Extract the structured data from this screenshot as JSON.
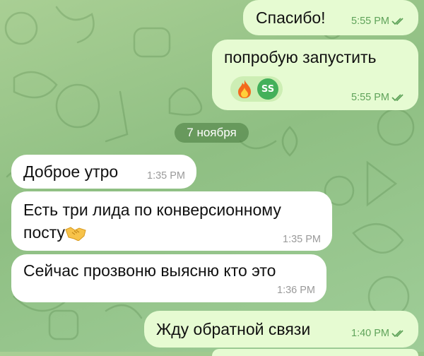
{
  "chat": {
    "date_separator": "7 ноября",
    "messages": [
      {
        "id": "m1",
        "direction": "outgoing",
        "text": "Спасибо!",
        "time": "5:55 PM",
        "status": "read"
      },
      {
        "id": "m2",
        "direction": "outgoing",
        "text": "попробую запустить",
        "time": "5:55 PM",
        "status": "read",
        "reaction": {
          "emoji": "fire-icon",
          "avatar_initials": "SS"
        }
      },
      {
        "id": "m3",
        "direction": "incoming",
        "text": "Доброе утро",
        "time": "1:35 PM"
      },
      {
        "id": "m4",
        "direction": "incoming",
        "text_line1": "Есть три лида по конверсионному",
        "text_line2": "посту",
        "emoji": "handshake-icon",
        "time": "1:35 PM"
      },
      {
        "id": "m5",
        "direction": "incoming",
        "text": "Сейчас прозвоню выясню кто это",
        "time": "1:36 PM"
      },
      {
        "id": "m6",
        "direction": "outgoing",
        "text": "Жду обратной связи",
        "time": "1:40 PM",
        "status": "read"
      }
    ]
  },
  "colors": {
    "outgoing_bubble": "#e6fbd2",
    "incoming_bubble": "#ffffff",
    "outgoing_meta": "#5fa35a",
    "wallpaper": "#9fc98f",
    "avatar": "#43b05a"
  }
}
